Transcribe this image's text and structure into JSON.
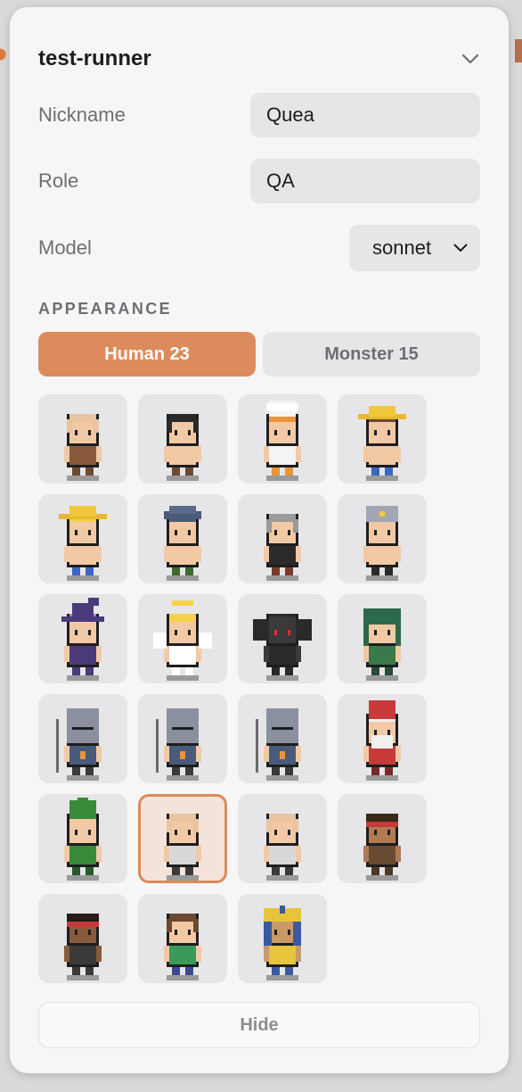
{
  "panel": {
    "title": "test-runner"
  },
  "form": {
    "nickname_label": "Nickname",
    "nickname_value": "Quea",
    "role_label": "Role",
    "role_value": "QA",
    "model_label": "Model",
    "model_value": "sonnet"
  },
  "appearance": {
    "section_label": "APPEARANCE",
    "tabs": [
      {
        "label": "Human 23",
        "active": true
      },
      {
        "label": "Monster 15",
        "active": false
      }
    ],
    "selected_index": 17,
    "characters": [
      {
        "name": "bald-brawler-icon",
        "hat": "none",
        "hair": "#e8c4a0",
        "skin": "#f2c9a5",
        "shirt": "#8a5a3c",
        "pants": "#6b4a32"
      },
      {
        "name": "black-hair-villager-icon",
        "hat": "none",
        "hair": "#2a2a2a",
        "skin": "#f2c9a5",
        "shirt": "#f2c9a5",
        "pants": "#6b4a32"
      },
      {
        "name": "chef-icon",
        "hat": "chef",
        "hair": "#e8943a",
        "skin": "#f2c9a5",
        "shirt": "#f4f4f4",
        "pants": "#e8943a"
      },
      {
        "name": "straw-hat-farmer-icon",
        "hat": "straw",
        "hair": "#6b4a32",
        "skin": "#f2c9a5",
        "shirt": "#f2c9a5",
        "pants": "#3a66c4"
      },
      {
        "name": "blonde-farmer-icon",
        "hat": "straw",
        "hair": "#f5d04a",
        "skin": "#f2c9a5",
        "shirt": "#f2c9a5",
        "pants": "#3a66c4"
      },
      {
        "name": "blue-cap-worker-icon",
        "hat": "cap",
        "hair": "#4a5a7a",
        "skin": "#f2c9a5",
        "shirt": "#f2c9a5",
        "pants": "#3a6a2c"
      },
      {
        "name": "gray-hair-elder-icon",
        "hat": "none",
        "hair": "#9a9a9a",
        "skin": "#f2c9a5",
        "shirt": "#2a2a2a",
        "pants": "#7a3a2a"
      },
      {
        "name": "helmet-soldier-icon",
        "hat": "helmet",
        "hair": "#a0a6b4",
        "skin": "#f2c9a5",
        "shirt": "#f2c9a5",
        "pants": "#2a2a2a"
      },
      {
        "name": "witch-icon",
        "hat": "witch",
        "hair": "#b07ad0",
        "skin": "#f2c9a5",
        "shirt": "#4a3a7a",
        "pants": "#4a3a7a"
      },
      {
        "name": "angel-icon",
        "hat": "halo",
        "hair": "#f5d04a",
        "skin": "#f2c9a5",
        "shirt": "#ffffff",
        "pants": "#ffffff"
      },
      {
        "name": "dark-bat-icon",
        "hat": "bat",
        "hair": "#2a2a2a",
        "skin": "#3a3a3a",
        "shirt": "#2a2a2a",
        "pants": "#2a2a2a"
      },
      {
        "name": "hooded-archer-icon",
        "hat": "hood",
        "hair": "#2a6a4a",
        "skin": "#f2c9a5",
        "shirt": "#3a7a4a",
        "pants": "#2a4a3a"
      },
      {
        "name": "spear-knight-icon",
        "hat": "knight",
        "hair": "#8a90a0",
        "skin": "#f2c9a5",
        "shirt": "#4a5a7a",
        "pants": "#3a3a3a"
      },
      {
        "name": "sword-knight-icon",
        "hat": "knight",
        "hair": "#8a90a0",
        "skin": "#f2c9a5",
        "shirt": "#4a5a7a",
        "pants": "#3a3a3a"
      },
      {
        "name": "halberd-knight-icon",
        "hat": "knight",
        "hair": "#8a90a0",
        "skin": "#f2c9a5",
        "shirt": "#4a5a7a",
        "pants": "#3a3a3a"
      },
      {
        "name": "red-gnome-icon",
        "hat": "gnome-red",
        "hair": "#f0f0f0",
        "skin": "#f2c9a5",
        "shirt": "#c83a3a",
        "pants": "#7a2a2a"
      },
      {
        "name": "green-gnome-icon",
        "hat": "gnome-green",
        "hair": "#f2c9a5",
        "skin": "#f2c9a5",
        "shirt": "#3a8a3a",
        "pants": "#2a5a2a"
      },
      {
        "name": "bald-monk-icon",
        "hat": "none",
        "hair": "#e8c4a0",
        "skin": "#f2c9a5",
        "shirt": "#d8d8d8",
        "pants": "#3a3a3a"
      },
      {
        "name": "bald-monk-alt-icon",
        "hat": "none",
        "hair": "#e8c4a0",
        "skin": "#f2c9a5",
        "shirt": "#d8d8d8",
        "pants": "#3a3a3a"
      },
      {
        "name": "headband-warrior-icon",
        "hat": "headband",
        "hair": "#3a2a1a",
        "skin": "#b07a54",
        "shirt": "#6a4a32",
        "pants": "#4a3a2a"
      },
      {
        "name": "headband-warrior-dark-icon",
        "hat": "headband",
        "hair": "#2a1a1a",
        "skin": "#8a5a3c",
        "shirt": "#3a3a3a",
        "pants": "#3a3a3a"
      },
      {
        "name": "brown-hair-boy-icon",
        "hat": "none",
        "hair": "#6b4a32",
        "skin": "#f2c9a5",
        "shirt": "#3a9a5a",
        "pants": "#3a4a8a"
      },
      {
        "name": "pharaoh-icon",
        "hat": "pharaoh",
        "hair": "#e8c43a",
        "skin": "#c89a6a",
        "shirt": "#e8c43a",
        "pants": "#3a5aa0"
      }
    ]
  },
  "footer": {
    "hide_label": "Hide"
  }
}
